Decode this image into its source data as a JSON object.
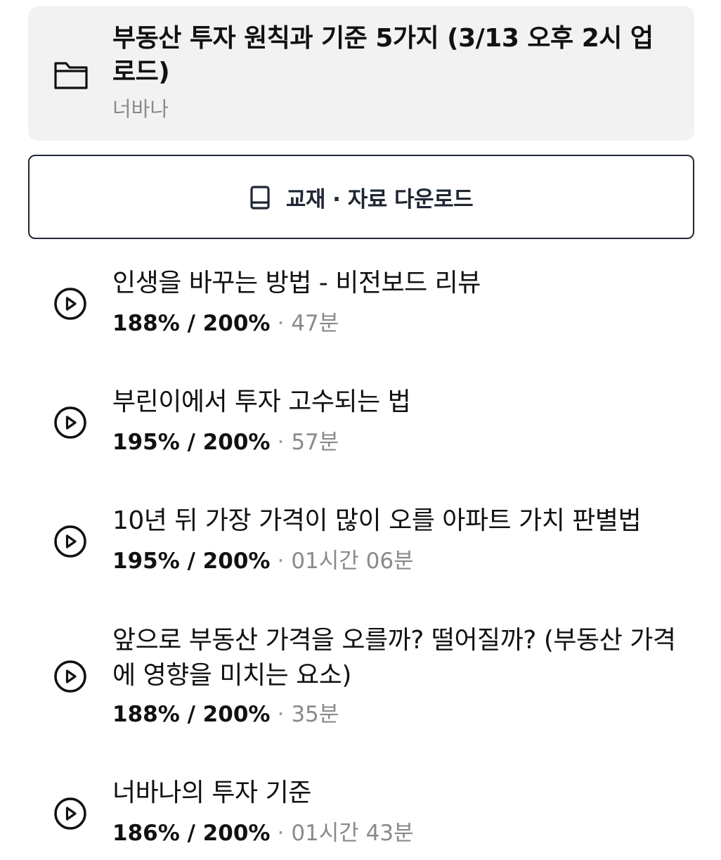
{
  "folder": {
    "icon": "folder-icon",
    "title": "부동산 투자 원칙과 기준 5가지 (3/13 오후 2시 업로드)",
    "author": "너바나"
  },
  "download": {
    "icon": "book-icon",
    "label": "교재 · 자료 다운로드"
  },
  "lessons": [
    {
      "title": "인생을 바꾸는 방법 - 비전보드 리뷰",
      "progress": "188% / 200%",
      "separator": "·",
      "duration": "47분"
    },
    {
      "title": "부린이에서 투자 고수되는 법",
      "progress": "195% / 200%",
      "separator": "·",
      "duration": "57분"
    },
    {
      "title": "10년 뒤 가장 가격이 많이 오를 아파트 가치 판별법",
      "progress": "195% / 200%",
      "separator": "·",
      "duration": "01시간 06분"
    },
    {
      "title": "앞으로 부동산 가격을 오를까? 떨어질까? (부동산 가격에 영향을 미치는 요소)",
      "progress": "188% / 200%",
      "separator": "·",
      "duration": "35분"
    },
    {
      "title": "너바나의 투자 기준",
      "progress": "186% / 200%",
      "separator": "·",
      "duration": "01시간 43분"
    }
  ],
  "colors": {
    "card_background": "#f2f2f2",
    "text_primary": "#111111",
    "text_secondary": "#8a8a8a",
    "button_border": "#1f2733"
  }
}
